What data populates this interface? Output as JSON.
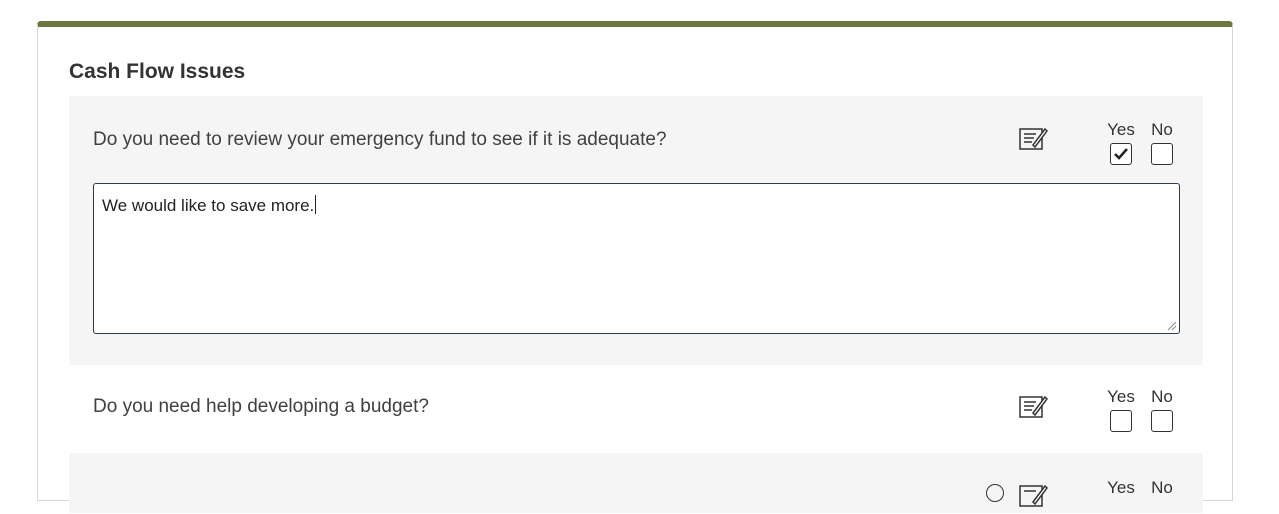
{
  "section": {
    "title": "Cash Flow Issues"
  },
  "questions": [
    {
      "text": "Do you need to review your emergency fund to see if it is adequate?",
      "yes_label": "Yes",
      "no_label": "No",
      "yes_checked": true,
      "no_checked": false,
      "notes_open": true,
      "notes_value": "We would like to save more."
    },
    {
      "text": "Do you need help developing a budget?",
      "yes_label": "Yes",
      "no_label": "No",
      "yes_checked": false,
      "no_checked": false,
      "notes_open": false
    },
    {
      "text": "",
      "yes_label": "Yes",
      "no_label": "No",
      "yes_checked": false,
      "no_checked": false,
      "notes_open": false
    }
  ],
  "icons": {
    "notes": "notes-edit-icon",
    "checked": "checkmark-icon",
    "partial": "help-circle-icon"
  },
  "colors": {
    "accent_border": "#6b7a3a",
    "row_shade": "#f5f5f5",
    "textarea_border": "#2b3a55"
  }
}
